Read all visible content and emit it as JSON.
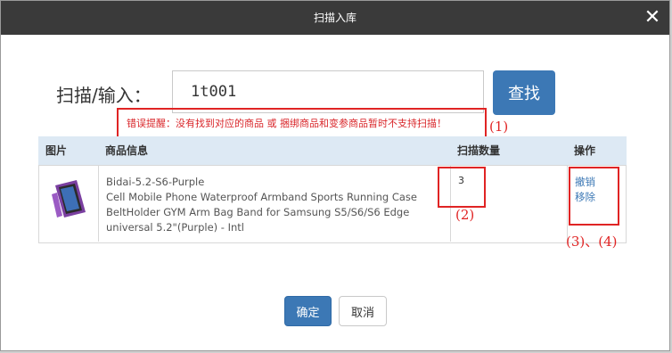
{
  "modal": {
    "title": "扫描入库",
    "close_icon": "close-icon"
  },
  "scan": {
    "label": "扫描/输入：",
    "value": "1t001",
    "find_label": "查找"
  },
  "error": {
    "text": "错误提醒：没有找到对应的商品 或 捆绑商品和变参商品暂时不支持扫描！"
  },
  "table": {
    "headers": [
      "图片",
      "商品信息",
      "扫描数量",
      "操作"
    ],
    "rows": [
      {
        "image_icon": "armband-product-image",
        "sku": "Bidai-5.2-S6-Purple",
        "desc_line1": "Cell Mobile Phone Waterproof Armband Sports Running Case",
        "desc_line2": "BeltHolder GYM Arm Bag Band for Samsung S5/S6/S6 Edge",
        "desc_line3": "universal 5.2\"(Purple) - Intl",
        "qty": "3",
        "action_undo": "撤销",
        "action_remove": "移除"
      }
    ]
  },
  "annotations": {
    "a1": "(1)",
    "a2": "(2)",
    "a34": "(3)、(4)"
  },
  "footer": {
    "confirm_label": "确定",
    "cancel_label": "取消"
  },
  "colors": {
    "header_bg": "#3a3a3a",
    "primary": "#3c78b5",
    "error": "#d9262a",
    "annotation": "#e02424",
    "table_header_bg": "#dde9f4"
  }
}
